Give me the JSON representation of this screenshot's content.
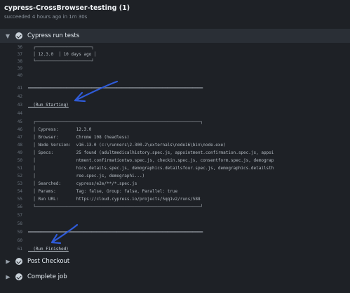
{
  "header": {
    "title": "cypress-CrossBrowser-testing (1)",
    "subtitle": "succeeded 4 hours ago in 1m 30s"
  },
  "step": {
    "label": "Cypress run tests"
  },
  "log_lines": [
    {
      "n": "36",
      "t": "  ┌──────────────────────┐"
    },
    {
      "n": "37",
      "t": "  │ 12.3.0  │ 10 days ago │"
    },
    {
      "n": "38",
      "t": "  └──────────────────────┘"
    },
    {
      "n": "39",
      "t": ""
    },
    {
      "n": "40",
      "t": ""
    },
    {
      "n": "41",
      "t": "═════════════════════════════════════════════════════════════════════"
    },
    {
      "n": "42",
      "t": ""
    },
    {
      "n": "43",
      "t": "  (Run Starting)"
    },
    {
      "n": "44",
      "t": ""
    },
    {
      "n": "45",
      "t": "  ┌─────────────────────────────────────────────────────────────────┐"
    },
    {
      "n": "46",
      "t": "  │ Cypress:       12.3.0"
    },
    {
      "n": "47",
      "t": "  │ Browser:       Chrome 108 (headless)"
    },
    {
      "n": "48",
      "t": "  │ Node Version:  v16.13.0 (c:\\runners\\2.300.2\\externals\\node16\\bin\\node.exe)"
    },
    {
      "n": "49",
      "t": "  │ Specs:         25 found (adultmedicalhistory.spec.js, appointment.confirmation.spec.js, appoi"
    },
    {
      "n": "50",
      "t": "  │                ntment.confirmationtwo.spec.js, checkin.spec.js, consentform.spec.js, demograp"
    },
    {
      "n": "51",
      "t": "  │                hics.details.spec.js, demographics.detailsfour.spec.js, demographics.detailsth"
    },
    {
      "n": "52",
      "t": "  │                ree.spec.js, demographi...)"
    },
    {
      "n": "53",
      "t": "  │ Searched:      cypress/e2e/**/*.spec.js"
    },
    {
      "n": "54",
      "t": "  │ Params:        Tag: false, Group: false, Parallel: true"
    },
    {
      "n": "55",
      "t": "  │ Run URL:       https://cloud.cypress.io/projects/5qq1v2/runs/588"
    },
    {
      "n": "56",
      "t": "  └─────────────────────────────────────────────────────────────────┘"
    },
    {
      "n": "57",
      "t": ""
    },
    {
      "n": "58",
      "t": ""
    },
    {
      "n": "59",
      "t": "═════════════════════════════════════════════════════════════════════"
    },
    {
      "n": "60",
      "t": ""
    },
    {
      "n": "61",
      "t": "  (Run Finished)"
    }
  ],
  "collapsed_steps": [
    {
      "label": "Post Checkout"
    },
    {
      "label": "Complete job"
    }
  ],
  "colors": {
    "annotation_arrow": "#2f5bd8"
  }
}
